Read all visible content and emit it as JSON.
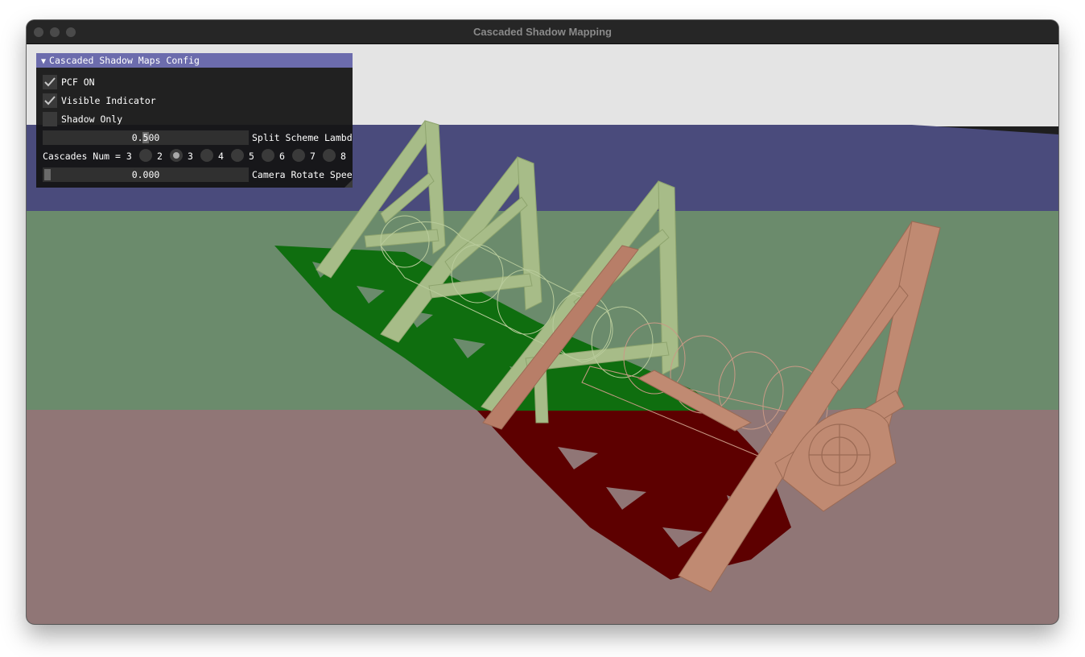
{
  "window": {
    "title": "Cascaded Shadow Mapping"
  },
  "colors": {
    "sky": "#e4e4e4",
    "cascade_blue": "#4a4b7c",
    "cascade_green": "#6b8b6c",
    "cascade_red": "#907676",
    "model_green": "#a7bc88",
    "model_red": "#c08a72",
    "shadow_green": "#0f6e0f",
    "shadow_red": "#5d0000",
    "panel_header": "#6c6cad"
  },
  "config_panel": {
    "title": "Cascaded Shadow Maps Config",
    "collapse_icon": "triangle-down-icon",
    "pcf": {
      "label": "PCF ON",
      "checked": true
    },
    "visible_indicator": {
      "label": "Visible Indicator",
      "checked": true
    },
    "shadow_only": {
      "label": "Shadow Only",
      "checked": false
    },
    "split_lambda": {
      "value": "0.500",
      "label": "Split Scheme Lambda",
      "fraction": 0.5
    },
    "cascades": {
      "label": "Cascades Num = 3",
      "options": [
        "2",
        "3",
        "4",
        "5",
        "6",
        "7",
        "8"
      ],
      "selected": "3"
    },
    "camera_speed": {
      "value": "0.000",
      "label": "Camera Rotate Speed",
      "fraction": 0.0
    }
  }
}
